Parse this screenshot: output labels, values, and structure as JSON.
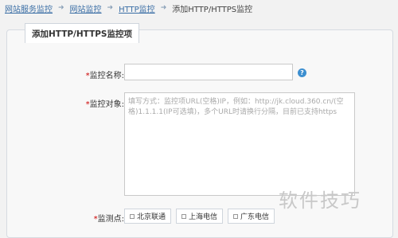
{
  "breadcrumb": {
    "items": [
      "网站服务监控",
      "网站监控",
      "HTTP监控"
    ],
    "current": "添加HTTP/HTTPS监控",
    "separator": "➜"
  },
  "panel": {
    "title": "添加HTTP/HTTPS监控项"
  },
  "form": {
    "name_label": "监控名称:",
    "target_label": "监控对象:",
    "target_placeholder": "填写方式：监控项URL(空格)IP，例如：http://jk.cloud.360.cn/(空格)1.1.1.1(IP可选填)，多个URL时请换行分隔，目前已支持https",
    "nodes_label": "监测点:",
    "required_mark": "*",
    "help_icon": "?",
    "nodes": [
      "北京联通",
      "上海电信",
      "广东电信"
    ]
  },
  "watermark": "软件技巧"
}
